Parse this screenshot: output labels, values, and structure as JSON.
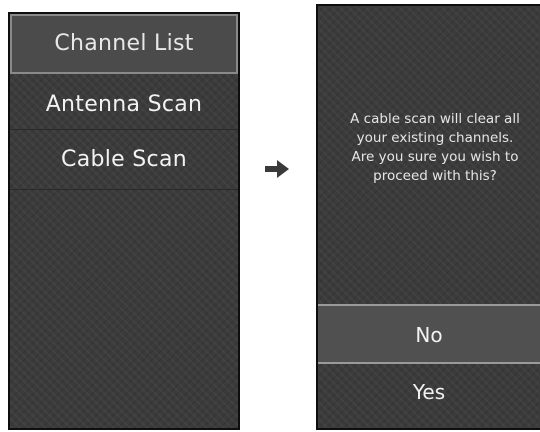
{
  "left_menu": {
    "items": [
      {
        "label": "Channel List",
        "selected": true
      },
      {
        "label": "Antenna Scan",
        "selected": false
      },
      {
        "label": "Cable Scan",
        "selected": false
      }
    ]
  },
  "dialog": {
    "message": "A cable scan will clear all\nyour existing channels.\nAre you sure you wish to\nproceed with this?",
    "buttons": [
      {
        "label": "No",
        "selected": true
      },
      {
        "label": "Yes",
        "selected": false
      }
    ]
  },
  "icons": {
    "transition": "arrow-right-icon"
  },
  "colors": {
    "panel_bg": "#3b3b3b",
    "selected_bg": "#4b4b4b",
    "selected_border": "#8a8a8a",
    "text": "#f2f2f2"
  }
}
